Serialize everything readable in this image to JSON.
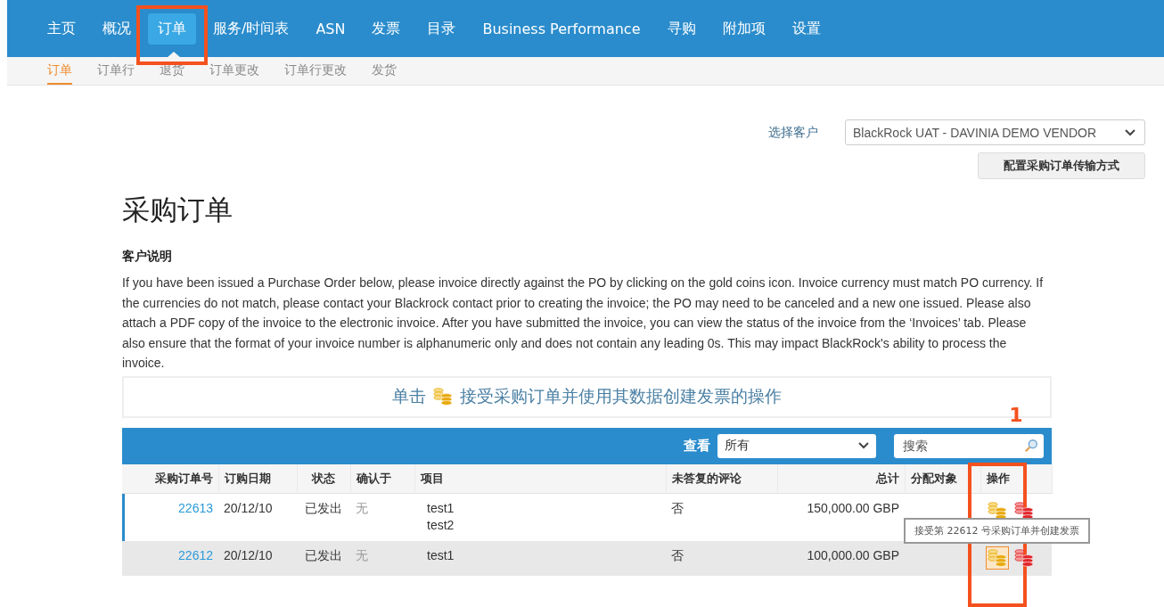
{
  "nav": {
    "tabs": [
      {
        "label": "主页",
        "selected": false,
        "highlighted": false
      },
      {
        "label": "概况",
        "selected": false,
        "highlighted": false
      },
      {
        "label": "订单",
        "selected": true,
        "highlighted": true
      },
      {
        "label": "服务/时间表",
        "selected": false,
        "highlighted": false
      },
      {
        "label": "ASN",
        "selected": false,
        "highlighted": false
      },
      {
        "label": "发票",
        "selected": false,
        "highlighted": false
      },
      {
        "label": "目录",
        "selected": false,
        "highlighted": false
      },
      {
        "label": "Business Performance",
        "selected": false,
        "highlighted": false
      },
      {
        "label": "寻购",
        "selected": false,
        "highlighted": false
      },
      {
        "label": "附加项",
        "selected": false,
        "highlighted": false
      },
      {
        "label": "设置",
        "selected": false,
        "highlighted": false
      }
    ]
  },
  "subnav": {
    "tabs": [
      {
        "label": "订单",
        "selected": true
      },
      {
        "label": "订单行",
        "selected": false
      },
      {
        "label": "退货",
        "selected": false
      },
      {
        "label": "订单更改",
        "selected": false
      },
      {
        "label": "订单行更改",
        "selected": false
      },
      {
        "label": "发货",
        "selected": false
      }
    ]
  },
  "customer": {
    "label": "选择客户",
    "value": "BlackRock UAT - DAVINIA DEMO VENDOR"
  },
  "config_button": "配置采购订单传输方式",
  "title": "采购订单",
  "instructions": {
    "heading": "客户说明",
    "text": "If you have been issued a Purchase Order below, please invoice directly against the PO by clicking on the gold coins icon. Invoice currency must match PO currency. If the currencies do not match, please contact your Blackrock contact prior to creating the invoice; the PO may need to be canceled and a new one issued. Please also attach a PDF copy of the invoice to the electronic invoice. After you have submitted the invoice, you can view the status of the invoice from the ‘Invoices’ tab. Please also ensure that the format of your invoice number is alphanumeric only and does not contain any leading 0s. This may impact BlackRock's ability to process the invoice."
  },
  "banner": {
    "before": "单击",
    "after": "接受采购订单并使用其数据创建发票的操作"
  },
  "toolbar": {
    "view_label": "查看",
    "view_value": "所有",
    "search_placeholder": "搜索"
  },
  "table": {
    "columns": [
      {
        "label": "采购订单号",
        "highlighted": false
      },
      {
        "label": "订购日期",
        "highlighted": false
      },
      {
        "label": "状态",
        "highlighted": false
      },
      {
        "label": "确认于",
        "highlighted": false
      },
      {
        "label": "项目",
        "highlighted": false
      },
      {
        "label": "未答复的评论",
        "highlighted": false
      },
      {
        "label": "总计",
        "highlighted": false
      },
      {
        "label": "分配对象",
        "highlighted": false
      },
      {
        "label": "操作",
        "highlighted": true,
        "callout": "1"
      }
    ],
    "rows": [
      {
        "po": "22613",
        "date": "20/12/10",
        "status": "已发出",
        "confirmed": "无",
        "items": [
          "test1",
          "test2"
        ],
        "comments": "否",
        "total": "150,000.00 GBP",
        "selected": true,
        "hovered": false
      },
      {
        "po": "22612",
        "date": "20/12/10",
        "status": "已发出",
        "confirmed": "无",
        "items": [
          "test1"
        ],
        "comments": "否",
        "total": "100,000.00 GBP",
        "selected": false,
        "hovered": true,
        "tooltip": "接受第 22612 号采购订单并创建发票"
      }
    ]
  }
}
